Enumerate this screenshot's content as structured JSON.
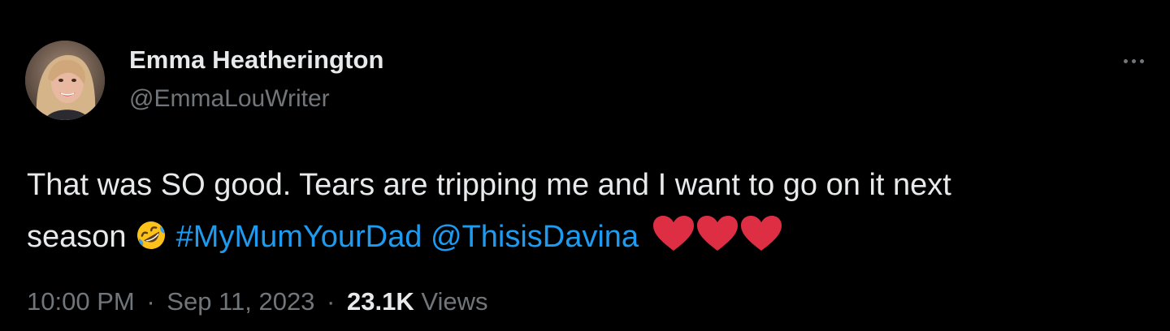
{
  "author": {
    "display_name": "Emma Heatherington",
    "handle": "@EmmaLouWriter"
  },
  "tweet": {
    "line1": "That was SO good. Tears are tripping me and I want to go on it next",
    "line2_prefix": "season",
    "emoji_laughing": "rolling-on-floor-laughing-emoji",
    "hashtag": "#MyMumYourDad",
    "mention": "@ThisisDavina",
    "hearts": [
      "red-heart-emoji",
      "red-heart-emoji",
      "red-heart-emoji"
    ]
  },
  "meta": {
    "time": "10:00 PM",
    "separator": "·",
    "date": "Sep 11, 2023",
    "views_count": "23.1K",
    "views_label": "Views"
  },
  "colors": {
    "background": "#000000",
    "text_primary": "#e7e9ea",
    "text_secondary": "#71767b",
    "link": "#1d9bf0",
    "heart": "#dd2e44"
  }
}
